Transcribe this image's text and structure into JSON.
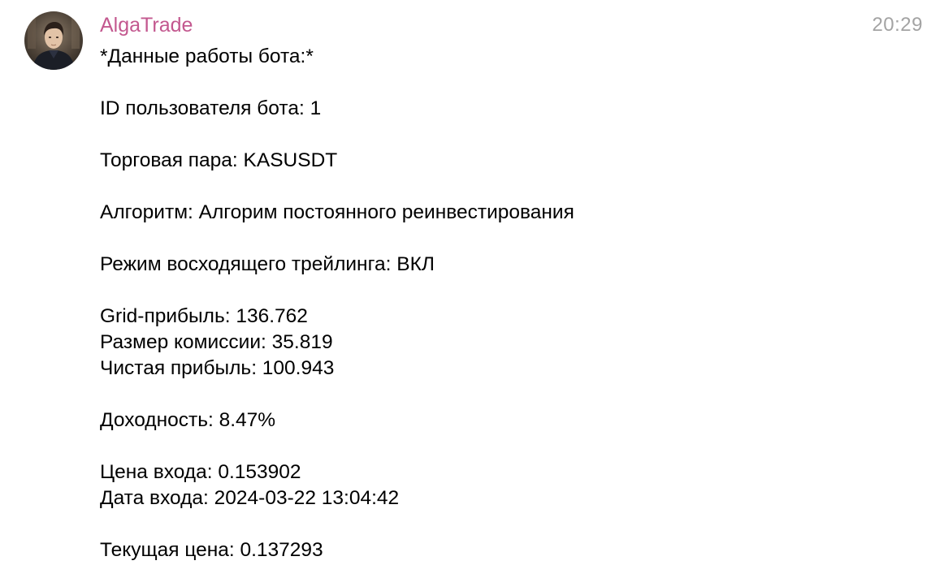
{
  "message": {
    "sender": "AlgaTrade",
    "time": "20:29",
    "lines": [
      "*Данные работы бота:*",
      "",
      "ID пользователя бота: 1",
      "",
      "Торговая пара: KASUSDT",
      "",
      "Алгоритм: Алгорим постоянного реинвестирования",
      "",
      "Режим восходящего трейлинга: ВКЛ",
      "",
      "Grid-прибыль: 136.762",
      "Размер комиссии: 35.819",
      "Чистая прибыль: 100.943",
      "",
      "Доходность: 8.47%",
      "",
      "Цена входа: 0.153902",
      "Дата входа: 2024-03-22 13:04:42",
      "",
      "Текущая цена: 0.137293"
    ]
  },
  "colors": {
    "sender": "#c3588f",
    "time": "#a3a3a3",
    "text": "#000000"
  },
  "icons": {
    "avatar": "user-avatar-photo"
  }
}
